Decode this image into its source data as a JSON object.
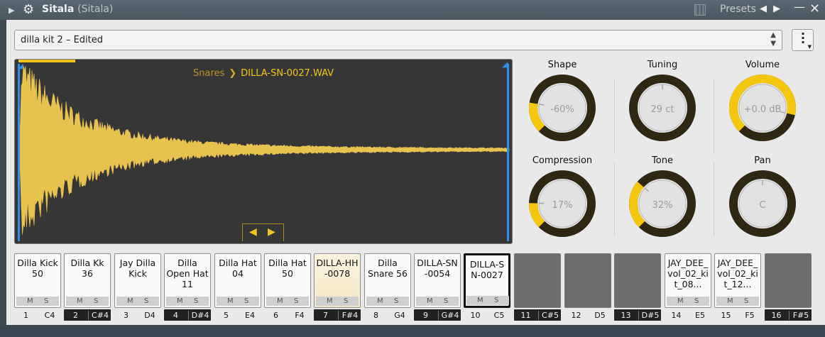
{
  "titlebar": {
    "plugin": "Sitala",
    "instance": "(Sitala)",
    "presets_label": "Presets"
  },
  "preset": {
    "name": "dilla kit 2 – Edited"
  },
  "waveform": {
    "category": "Snares",
    "file": "DILLA-SN-0027.WAV"
  },
  "knobs": [
    {
      "label": "Shape",
      "value": "-60%",
      "level": 0.2
    },
    {
      "label": "Tuning",
      "value": "29 ct",
      "level": 0.5
    },
    {
      "label": "Volume",
      "value": "+0.0 dB",
      "level": 0.88
    },
    {
      "label": "Compression",
      "value": "17%",
      "level": 0.17
    },
    {
      "label": "Tone",
      "value": "32%",
      "level": 0.32
    },
    {
      "label": "Pan",
      "value": "C",
      "level": 0.5
    }
  ],
  "pads": [
    {
      "name": "Dilla Kick 50",
      "num": "1",
      "key": "C4"
    },
    {
      "name": "Dilla Kk 36",
      "num": "2",
      "key": "C#4"
    },
    {
      "name": "Jay Dilla Kick",
      "num": "3",
      "key": "D4"
    },
    {
      "name": "Dilla Open Hat 11",
      "num": "4",
      "key": "D#4"
    },
    {
      "name": "Dilla Hat 04",
      "num": "5",
      "key": "E4"
    },
    {
      "name": "Dilla Hat 50",
      "num": "6",
      "key": "F4"
    },
    {
      "name": "DILLA-HH-0078",
      "num": "7",
      "key": "F#4"
    },
    {
      "name": "Dilla Snare 56",
      "num": "8",
      "key": "G4"
    },
    {
      "name": "DILLA-SN-0054",
      "num": "9",
      "key": "G#4"
    },
    {
      "name": "DILLA-SN-0027",
      "num": "10",
      "key": "C5"
    },
    {
      "name": "",
      "num": "11",
      "key": "C#5"
    },
    {
      "name": "",
      "num": "12",
      "key": "D5"
    },
    {
      "name": "",
      "num": "13",
      "key": "D#5"
    },
    {
      "name": "JAY_DEE_vol_02_kit_08...",
      "num": "14",
      "key": "E5"
    },
    {
      "name": "JAY_DEE_vol_02_kit_12...",
      "num": "15",
      "key": "F5"
    },
    {
      "name": "",
      "num": "16",
      "key": "F#5"
    }
  ],
  "pad_buttons": {
    "mute": "M",
    "solo": "S"
  },
  "colors": {
    "accent": "#f5c60e",
    "waveform_bg": "#363636",
    "knob_track": "#2e2812",
    "marker": "#2d8fe8"
  }
}
